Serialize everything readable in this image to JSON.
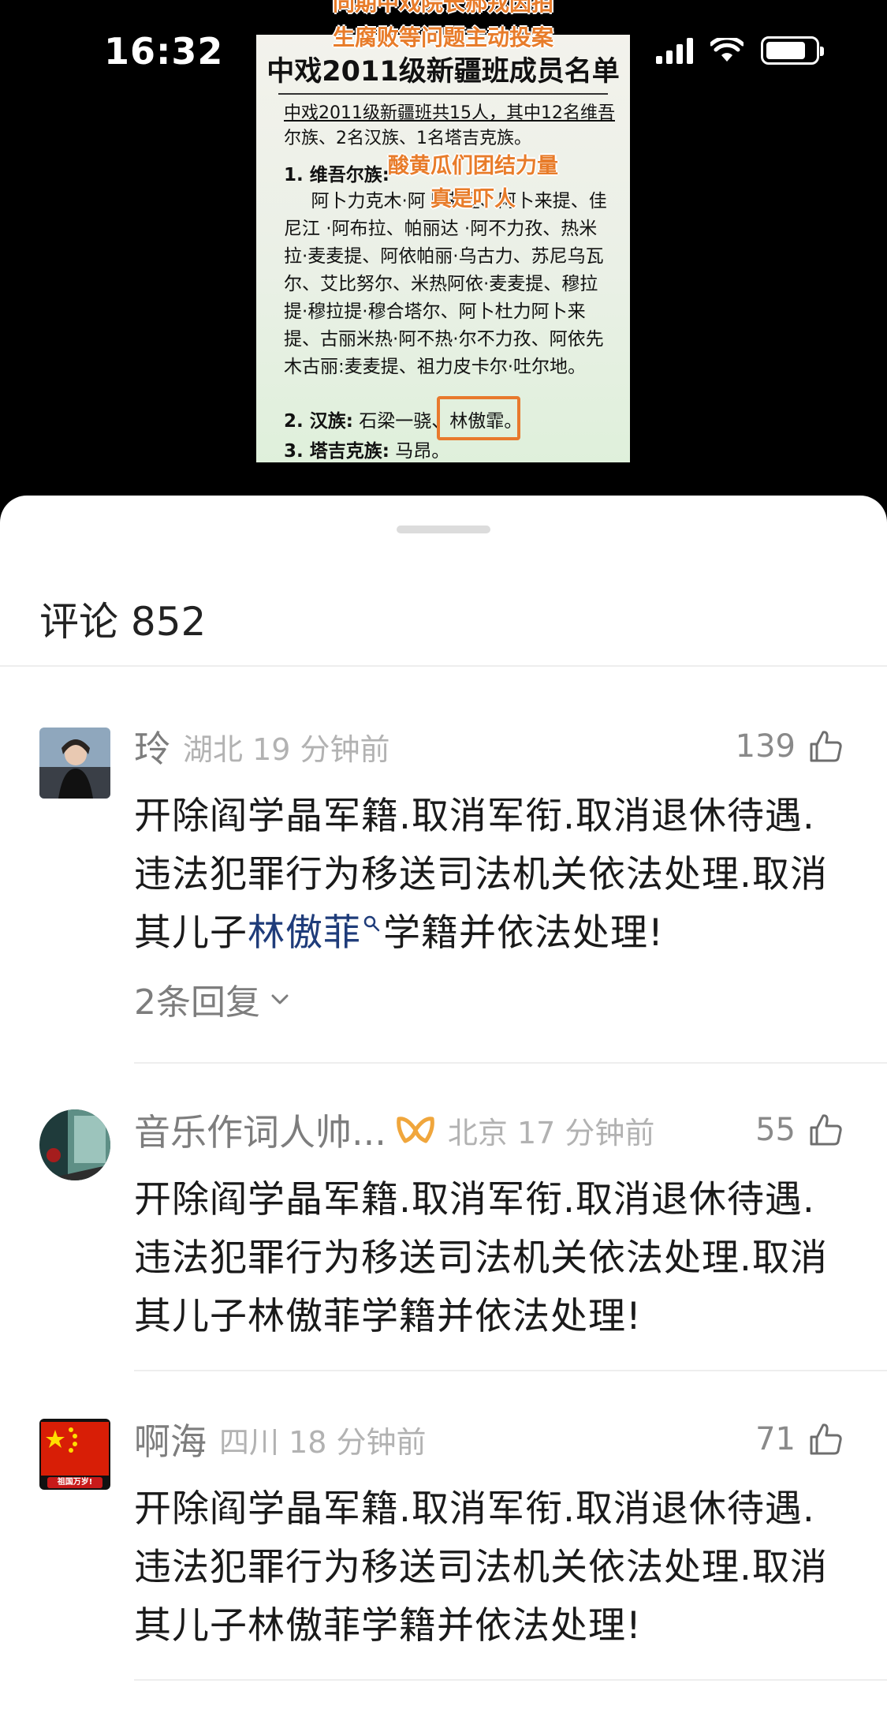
{
  "status_bar": {
    "time": "16:32"
  },
  "video": {
    "overlay_top_lines": [
      "同期中戏院长郝戎因拍",
      "生腐败等问题主动投案"
    ],
    "overlay_mid_lines": [
      "酸黄瓜们团结力量",
      "真是吓人"
    ],
    "document": {
      "title": "中戏2011级新疆班成员名单",
      "summary_line1": "中戏2011级新疆班共15人，其中12名维吾",
      "summary_line2": "尔族、2名汉族、1名塔吉克族。",
      "uyghur_heading": "1. 维吾尔族:",
      "uyghur_names": "阿卜力克木·阿卜来提、阿卜来提、佳尼江 ·阿布拉、帕丽达 ·阿不力孜、热米拉·麦麦提、阿依帕丽·乌古力、苏尼乌瓦尔、艾比努尔、米热阿依·麦麦提、穆拉提·穆拉提·穆合塔尔、阿卜杜力阿卜来提、古丽米热·阿不热·尔不力孜、阿依先木古丽:麦麦提、祖力皮卡尔·吐尔地。",
      "han_label": "2. 汉族:",
      "han_names": "石梁一骁、",
      "han_highlight": "林傲霏。",
      "tajik_label": "3. 塔吉克族:",
      "tajik_names": "马昂。"
    }
  },
  "comments_header": {
    "title": "评论 852"
  },
  "comments": [
    {
      "username": "玲",
      "vip": false,
      "location_time": "湖北 19 分钟前",
      "likes": "139",
      "text_before": "开除阎学晶军籍.取消军衔.取消退休待遇.违法犯罪行为移送司法机关依法处理.取消其儿子",
      "text_link": "林傲菲",
      "text_after": "学籍并依法处理!",
      "replies": "2条回复"
    },
    {
      "username": "音乐作词人帅...",
      "vip": true,
      "location_time": "北京 17 分钟前",
      "likes": "55",
      "text": "开除阎学晶军籍.取消军衔.取消退休待遇.违法犯罪行为移送司法机关依法处理.取消其儿子林傲菲学籍并依法处理!"
    },
    {
      "username": "啊海",
      "vip": false,
      "location_time": "四川 18 分钟前",
      "likes": "71",
      "text": "开除阎学晶军籍.取消军衔.取消退休待遇.违法犯罪行为移送司法机关依法处理.取消其儿子林傲菲学籍并依法处理!",
      "avatar_caption": "祖国万岁!"
    }
  ],
  "colors": {
    "overlay_orange": "#e87c2a",
    "link_blue": "#1f3c7a",
    "vip_gold": "#f0a63c"
  }
}
